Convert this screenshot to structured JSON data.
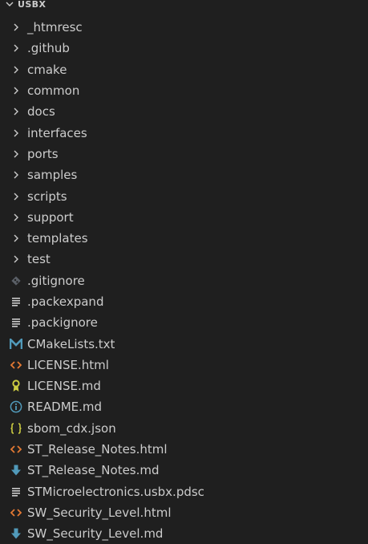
{
  "explorer": {
    "root_label": "USBX",
    "folders": [
      {
        "label": "_htmresc"
      },
      {
        "label": ".github"
      },
      {
        "label": "cmake"
      },
      {
        "label": "common"
      },
      {
        "label": "docs"
      },
      {
        "label": "interfaces"
      },
      {
        "label": "ports"
      },
      {
        "label": "samples"
      },
      {
        "label": "scripts"
      },
      {
        "label": "support"
      },
      {
        "label": "templates"
      },
      {
        "label": "test"
      }
    ],
    "files": [
      {
        "label": ".gitignore",
        "icon": "git-icon"
      },
      {
        "label": ".packexpand",
        "icon": "text-file-icon"
      },
      {
        "label": ".packignore",
        "icon": "text-file-icon"
      },
      {
        "label": "CMakeLists.txt",
        "icon": "cmake-icon"
      },
      {
        "label": "LICENSE.html",
        "icon": "html-icon"
      },
      {
        "label": "LICENSE.md",
        "icon": "license-icon"
      },
      {
        "label": "README.md",
        "icon": "info-icon"
      },
      {
        "label": "sbom_cdx.json",
        "icon": "json-icon"
      },
      {
        "label": "ST_Release_Notes.html",
        "icon": "html-icon"
      },
      {
        "label": "ST_Release_Notes.md",
        "icon": "markdown-icon"
      },
      {
        "label": "STMicroelectronics.usbx.pdsc",
        "icon": "text-file-icon"
      },
      {
        "label": "SW_Security_Level.html",
        "icon": "html-icon"
      },
      {
        "label": "SW_Security_Level.md",
        "icon": "markdown-icon"
      }
    ]
  },
  "colors": {
    "background": "#1f1f1f",
    "text": "#cccccc",
    "git": "#5a5f66",
    "html": "#e37933",
    "license": "#cbcb41",
    "info": "#519aba",
    "json": "#cbcb41",
    "markdown": "#519aba",
    "cmake": "#519aba"
  }
}
